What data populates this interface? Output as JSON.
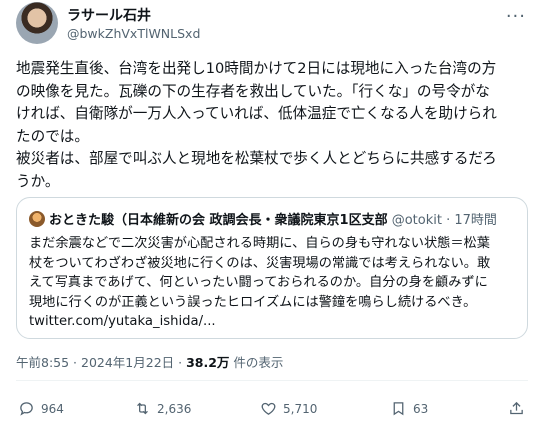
{
  "author": {
    "display_name": "ラサール石井",
    "handle": "@bwkZhVxTlWNLSxd"
  },
  "tweet": {
    "lines": [
      "地震発生直後、台湾を出発し10時間かけて2日には現地に入った台湾の方",
      "の映像を見た。瓦礫の下の生存者を救出していた。「行くな」の号令がな",
      "ければ、自衛隊が一万人入っていれば、低体温症で亡くなる人を助けられ",
      "たのでは。",
      "被災者は、部屋で叫ぶ人と現地を松葉杖で歩く人とどちらに共感するだろ",
      "うか。"
    ]
  },
  "quote": {
    "name": "おときた駿（日本維新の会 政調会長・衆議院東京1区支部",
    "handle": "@otokit",
    "time": "17時間",
    "lines": [
      "まだ余震などで二次災害が心配される時期に、自らの身も守れない状態＝松葉",
      "杖をついてわざわざ被災地に行くのは、災害現場の常識では考えられない。敢",
      "えて写真まであげて、何といったい闘っておられるのか。自分の身を顧みずに",
      "現地に行くのが正義という誤ったヒロイズムには警鐘を鳴らし続けるべき。",
      "twitter.com/yutaka_ishida/..."
    ]
  },
  "meta": {
    "time": "午前8:55",
    "sep": " · ",
    "date": "2024年1月22日",
    "views": "38.2万",
    "views_label": " 件の表示"
  },
  "actions": {
    "reply": "964",
    "retweet": "2,636",
    "like": "5,710",
    "bookmark": "63"
  },
  "icons": {
    "more": "more-icon",
    "reply": "reply-icon",
    "retweet": "retweet-icon",
    "like": "heart-icon",
    "bookmark": "bookmark-icon",
    "share": "share-icon"
  }
}
